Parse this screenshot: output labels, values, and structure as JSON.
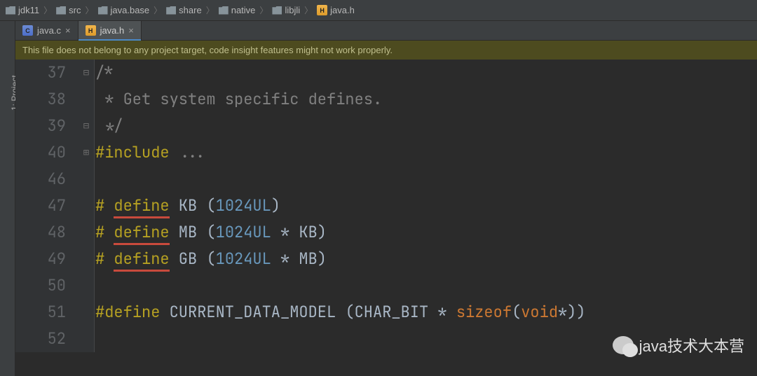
{
  "breadcrumb": [
    {
      "icon": "folder",
      "label": "jdk11"
    },
    {
      "icon": "folder",
      "label": "src"
    },
    {
      "icon": "folder",
      "label": "java.base"
    },
    {
      "icon": "folder",
      "label": "share"
    },
    {
      "icon": "folder",
      "label": "native"
    },
    {
      "icon": "folder",
      "label": "libjli"
    },
    {
      "icon": "hfile",
      "label": "java.h"
    }
  ],
  "toolstrip": {
    "project_label": "1: Project"
  },
  "tabs": [
    {
      "icon": "cfile",
      "label": "java.c",
      "active": false
    },
    {
      "icon": "hfile",
      "label": "java.h",
      "active": true
    }
  ],
  "banner": {
    "text": "This file does not belong to any project target, code insight features might not work properly."
  },
  "code_lines": [
    {
      "n": "37",
      "fold": "⊟",
      "seg": [
        {
          "t": "/*",
          "cls": "c-comment"
        }
      ]
    },
    {
      "n": "38",
      "fold": "",
      "seg": [
        {
          "t": " * Get system specific defines.",
          "cls": "c-comment"
        }
      ]
    },
    {
      "n": "39",
      "fold": "⊟",
      "seg": [
        {
          "t": " */",
          "cls": "c-comment"
        }
      ]
    },
    {
      "n": "40",
      "fold": "⊞",
      "seg": [
        {
          "t": "#include ",
          "cls": "c-macro"
        },
        {
          "t": "...",
          "cls": "c-fade"
        }
      ]
    },
    {
      "n": "46",
      "fold": "",
      "seg": [
        {
          "t": "",
          "cls": ""
        }
      ]
    },
    {
      "n": "47",
      "fold": "",
      "seg": [
        {
          "t": "# ",
          "cls": "c-macro"
        },
        {
          "t": "define",
          "cls": "c-macro",
          "u": true
        },
        {
          "t": " KB (",
          "cls": "c-op"
        },
        {
          "t": "1024UL",
          "cls": "c-num"
        },
        {
          "t": ")",
          "cls": "c-op"
        }
      ]
    },
    {
      "n": "48",
      "fold": "",
      "seg": [
        {
          "t": "# ",
          "cls": "c-macro"
        },
        {
          "t": "define",
          "cls": "c-macro",
          "u": true
        },
        {
          "t": " MB (",
          "cls": "c-op"
        },
        {
          "t": "1024UL",
          "cls": "c-num"
        },
        {
          "t": " * KB)",
          "cls": "c-op"
        }
      ]
    },
    {
      "n": "49",
      "fold": "",
      "seg": [
        {
          "t": "# ",
          "cls": "c-macro"
        },
        {
          "t": "define",
          "cls": "c-macro",
          "u": true
        },
        {
          "t": " GB (",
          "cls": "c-op"
        },
        {
          "t": "1024UL",
          "cls": "c-num"
        },
        {
          "t": " * MB)",
          "cls": "c-op"
        }
      ]
    },
    {
      "n": "50",
      "fold": "",
      "seg": [
        {
          "t": "",
          "cls": ""
        }
      ]
    },
    {
      "n": "51",
      "fold": "",
      "seg": [
        {
          "t": "#define",
          "cls": "c-macro"
        },
        {
          "t": " CURRENT_DATA_MODEL (CHAR_BIT * ",
          "cls": "c-op"
        },
        {
          "t": "sizeof",
          "cls": "c-keyword"
        },
        {
          "t": "(",
          "cls": "c-op"
        },
        {
          "t": "void",
          "cls": "c-keyword"
        },
        {
          "t": "*))",
          "cls": "c-op"
        }
      ]
    },
    {
      "n": "52",
      "fold": "",
      "seg": [
        {
          "t": "",
          "cls": ""
        }
      ]
    }
  ],
  "watermark": {
    "text": "java技术大本营"
  }
}
